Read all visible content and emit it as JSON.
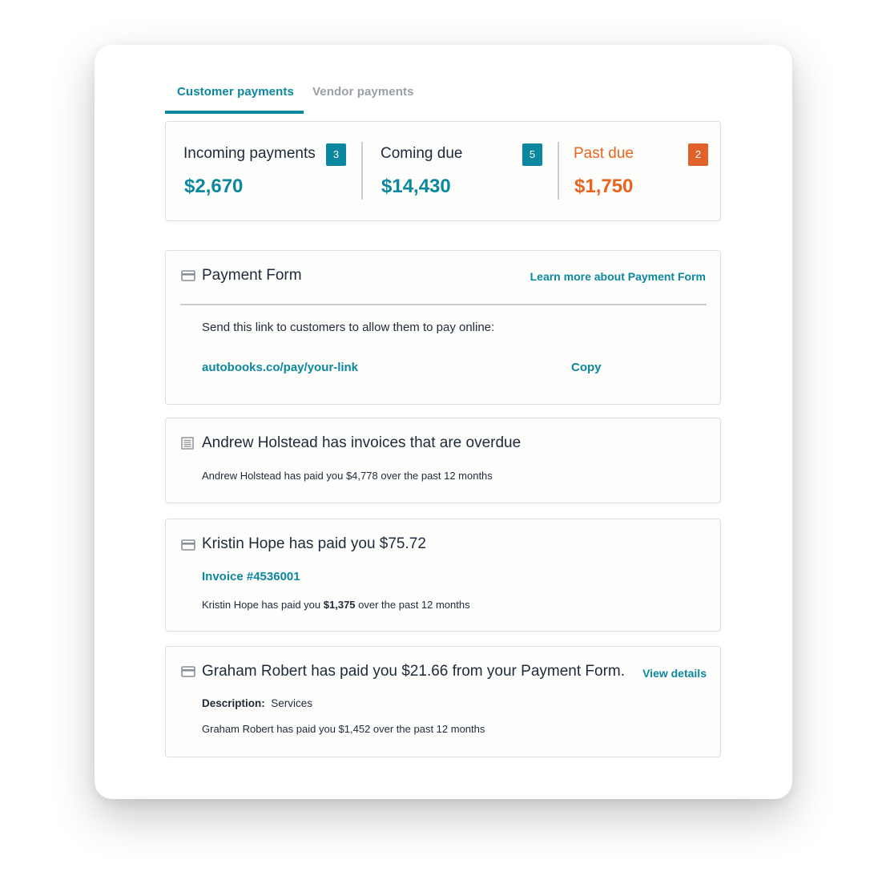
{
  "tabs": [
    {
      "label": "Customer payments",
      "active": true
    },
    {
      "label": "Vendor payments",
      "active": false
    }
  ],
  "summary": {
    "incoming": {
      "label": "Incoming payments",
      "count": "3",
      "amount": "$2,670"
    },
    "coming_due": {
      "label": "Coming due",
      "count": "5",
      "amount": "$14,430"
    },
    "past_due": {
      "label": "Past due",
      "count": "2",
      "amount": "$1,750"
    }
  },
  "payment_form": {
    "title": "Payment Form",
    "learn_more": "Learn more about Payment Form",
    "instruction": "Send this link to customers to allow them to pay online:",
    "link": "autobooks.co/pay/your-link",
    "copy_label": "Copy"
  },
  "activity": [
    {
      "icon": "document-list-icon",
      "title": "Andrew Holstead has invoices that are overdue",
      "summary": "Andrew Holstead has paid you $4,778 over the past 12 months"
    },
    {
      "icon": "credit-card-icon",
      "title": "Kristin Hope has paid you $75.72",
      "invoice_link": "Invoice #4536001",
      "summary_prefix": "Kristin Hope has paid you ",
      "summary_amount": "$1,375",
      "summary_suffix": " over the past 12 months"
    },
    {
      "icon": "credit-card-icon",
      "title": "Graham Robert has paid you $21.66 from your Payment Form.",
      "view_details": "View details",
      "description_label": "Description:",
      "description_value": "Services",
      "summary": "Graham Robert has paid you $1,452 over the past 12 months"
    }
  ],
  "colors": {
    "accent": "#0b879f",
    "warning": "#e8641f",
    "text": "#1e2a3a",
    "muted": "#9aa0a6"
  }
}
